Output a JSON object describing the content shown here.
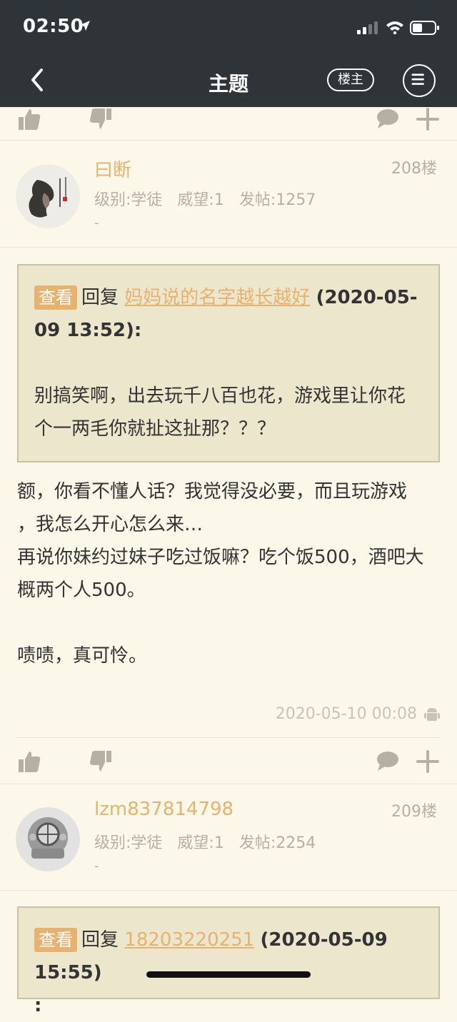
{
  "status_bar": {
    "time": "02:50"
  },
  "nav": {
    "title": "主题",
    "louzhu_label": "楼主"
  },
  "icons": {
    "back": "chevron-left-icon",
    "menu": "menu-icon",
    "like": "thumbs-up-icon",
    "dislike": "thumbs-down-icon",
    "comment": "comment-bubble-icon",
    "plus": "plus-icon",
    "android": "android-icon"
  },
  "colors": {
    "accent": "#e6b270",
    "nav_bg": "#2f3438",
    "page_bg": "#fbf8ea",
    "quote_bg": "#ece6cc"
  },
  "posts": [
    {
      "username": "曰断",
      "floor": "208楼",
      "level": "级别:学徒",
      "prestige": "威望:1",
      "posts_count": "发帖:1257",
      "signature": "-",
      "quote": {
        "view_label": "查看",
        "reply_label": "回复",
        "target_user": "妈妈说的名字越长越好",
        "date": "(2020-05-09 13:52):",
        "text": "别搞笑啊，出去玩千八百也花，游戏里让你花个一两毛你就扯这扯那？？？"
      },
      "body_lines": [
        "额，你看不懂人话？我觉得没必要，而且玩游戏",
        "，我怎么开心怎么来…",
        "再说你妹约过妹子吃过饭嘛？吃个饭500，酒吧大",
        "概两个人500。",
        "",
        "啧啧，真可怜。"
      ],
      "timestamp": "2020-05-10 00:08"
    },
    {
      "username": "lzm837814798",
      "floor": "209楼",
      "level": "级别:学徒",
      "prestige": "威望:1",
      "posts_count": "发帖:2254",
      "signature": "-",
      "quote": {
        "view_label": "查看",
        "reply_label": "回复",
        "target_user": "18203220251",
        "date": "(2020-05-09 15:55)",
        "date_tail": ":"
      }
    }
  ]
}
